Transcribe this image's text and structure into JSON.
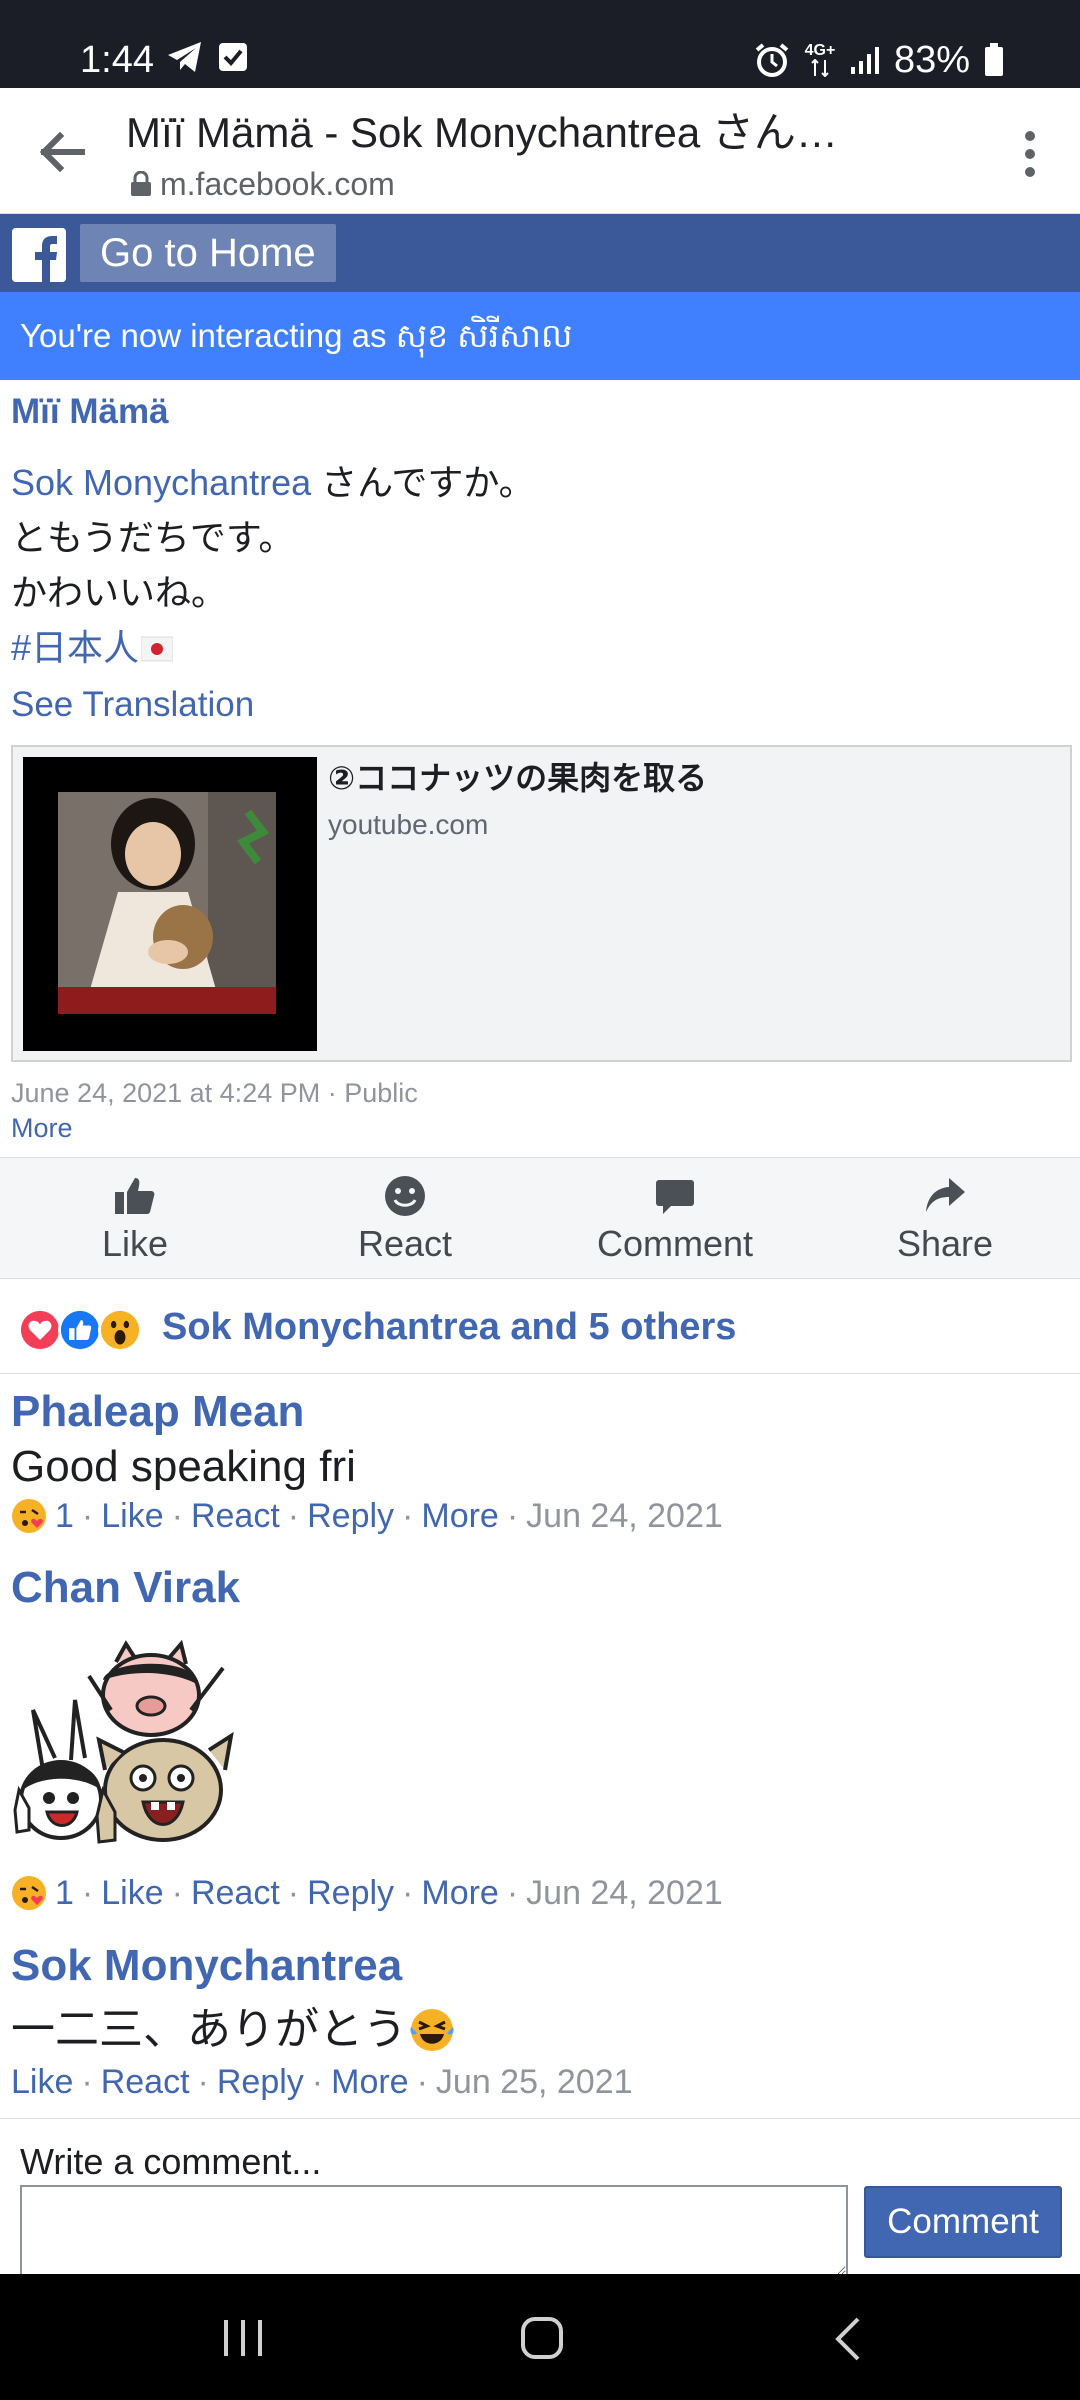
{
  "status_bar": {
    "time": "1:44",
    "network": "4G+",
    "battery": "83%"
  },
  "browser": {
    "page_title": "Mïï Mämä - Sok Monychantrea さん…",
    "domain": "m.facebook.com"
  },
  "fb_header": {
    "home_button": "Go to Home"
  },
  "banner": {
    "text": "You're now interacting as សុខ សិរីសាល"
  },
  "post": {
    "author": "Mïï Mämä",
    "mention": "Sok Monychantrea",
    "line1_suffix": " さんですか。",
    "line2": "ともうだちです。",
    "line3": "かわいいね。",
    "hashtag": "#日本人",
    "see_translation": "See Translation",
    "link_card": {
      "title": "②ココナッツの果肉を取る",
      "domain": "youtube.com"
    },
    "meta": "June 24, 2021 at 4:24 PM · Public",
    "more": "More"
  },
  "actions": [
    {
      "label": "Like",
      "icon": "thumbs-up-icon"
    },
    {
      "label": "React",
      "icon": "smiley-icon"
    },
    {
      "label": "Comment",
      "icon": "comment-icon"
    },
    {
      "label": "Share",
      "icon": "share-icon"
    }
  ],
  "reactions": {
    "summary": "Sok Monychantrea and 5 others"
  },
  "comments": [
    {
      "author": "Phaleap Mean",
      "text": "Good speaking fri",
      "reaction_count": "1",
      "like": "Like",
      "react": "React",
      "reply": "Reply",
      "more": "More",
      "date": "Jun 24, 2021"
    },
    {
      "author": "Chan Virak",
      "text": "",
      "reaction_count": "1",
      "like": "Like",
      "react": "React",
      "reply": "Reply",
      "more": "More",
      "date": "Jun 24, 2021"
    },
    {
      "author": "Sok Monychantrea",
      "text": "一二三、ありがとう",
      "like": "Like",
      "react": "React",
      "reply": "Reply",
      "more": "More",
      "date": "Jun 25, 2021"
    }
  ],
  "composer": {
    "label": "Write a comment...",
    "button": "Comment",
    "value": ""
  },
  "colors": {
    "fb_blue": "#3b5998",
    "link_blue": "#4267b2",
    "banner_blue": "#4080ff"
  }
}
